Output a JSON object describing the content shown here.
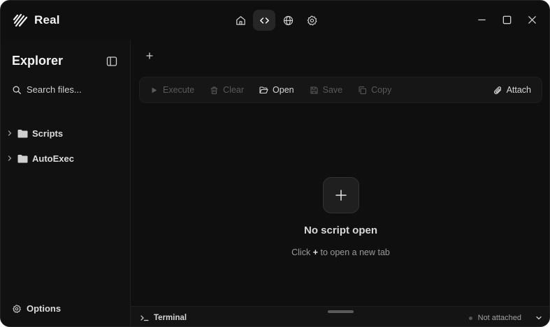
{
  "app": {
    "name": "Real",
    "logo_icon": "real-logo-icon"
  },
  "nav": [
    {
      "id": "home",
      "icon": "home-icon",
      "active": false
    },
    {
      "id": "editor",
      "icon": "code-icon",
      "active": true
    },
    {
      "id": "web",
      "icon": "globe-icon",
      "active": false
    },
    {
      "id": "settings",
      "icon": "gear-icon",
      "active": false
    }
  ],
  "window_controls": [
    "minimize-icon",
    "maximize-icon",
    "close-icon"
  ],
  "sidebar": {
    "title": "Explorer",
    "search_placeholder": "Search files...",
    "tree": [
      {
        "label": "Scripts",
        "type": "folder"
      },
      {
        "label": "AutoExec",
        "type": "folder"
      }
    ],
    "options_label": "Options"
  },
  "toolbar": {
    "execute": "Execute",
    "clear": "Clear",
    "open": "Open",
    "save": "Save",
    "copy": "Copy",
    "attach": "Attach"
  },
  "empty_state": {
    "title": "No script open",
    "sub_prefix": "Click",
    "sub_key": "+",
    "sub_suffix": "to open a new tab"
  },
  "terminal": {
    "label": "Terminal",
    "status": "Not attached"
  },
  "colors": {
    "background": "#0f0f0f",
    "sidebar": "#111111",
    "toolbar": "#161616",
    "disabled_text": "#5a5a5a",
    "text": "#dcdcdc"
  }
}
